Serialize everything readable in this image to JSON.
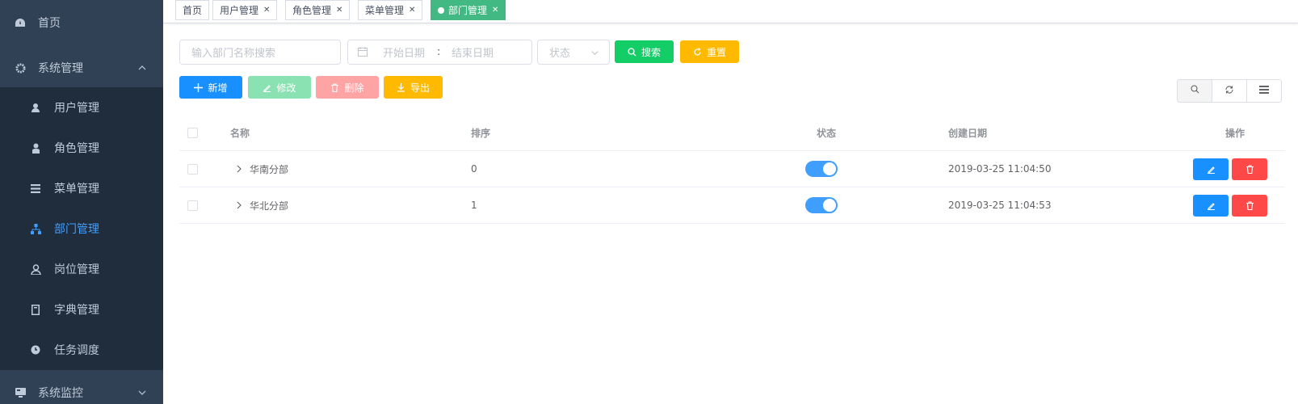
{
  "sidebar": {
    "home": "首页",
    "system": "系统管理",
    "items": [
      {
        "label": "用户管理",
        "icon": "user-icon"
      },
      {
        "label": "角色管理",
        "icon": "role-icon"
      },
      {
        "label": "菜单管理",
        "icon": "menu-icon"
      },
      {
        "label": "部门管理",
        "icon": "dept-icon"
      },
      {
        "label": "岗位管理",
        "icon": "post-icon"
      },
      {
        "label": "字典管理",
        "icon": "dict-icon"
      },
      {
        "label": "任务调度",
        "icon": "timing-icon"
      }
    ],
    "monitor": "系统监控",
    "active_index": 3
  },
  "tags": [
    {
      "label": "首页",
      "closable": false
    },
    {
      "label": "用户管理",
      "closable": true
    },
    {
      "label": "角色管理",
      "closable": true
    },
    {
      "label": "菜单管理",
      "closable": true
    },
    {
      "label": "部门管理",
      "closable": true,
      "active": true
    }
  ],
  "search": {
    "name_placeholder": "输入部门名称搜索",
    "start_placeholder": "开始日期",
    "range_separator": ":",
    "end_placeholder": "结束日期",
    "status_placeholder": "状态",
    "search_label": "搜索",
    "reset_label": "重置"
  },
  "toolbar": {
    "add": "新增",
    "edit": "修改",
    "delete": "删除",
    "export": "导出"
  },
  "table": {
    "headers": [
      "名称",
      "排序",
      "状态",
      "创建日期",
      "操作"
    ],
    "rows": [
      {
        "name": "华南分部",
        "sort": "0",
        "enabled": true,
        "created": "2019-03-25 11:04:50"
      },
      {
        "name": "华北分部",
        "sort": "1",
        "enabled": true,
        "created": "2019-03-25 11:04:53"
      }
    ]
  },
  "colors": {
    "sidebar_bg": "#304156",
    "submenu_bg": "#1f2d3d",
    "active_text": "#409eff",
    "tag_active": "#42b983",
    "primary": "#1890ff",
    "success": "#13ce66",
    "warning": "#ffba00",
    "danger": "#ff4949"
  }
}
